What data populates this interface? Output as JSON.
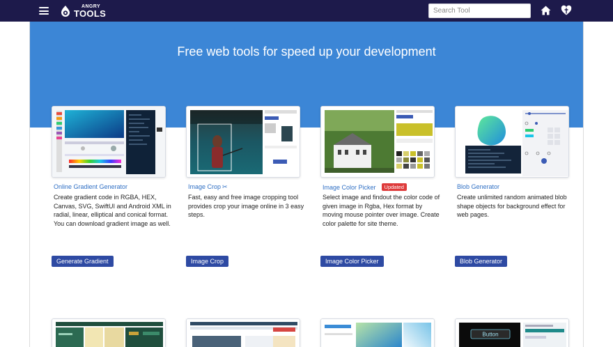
{
  "header": {
    "logo_top": "ANGRY",
    "logo_bottom": "TOOLS",
    "search_placeholder": "Search Tool"
  },
  "hero": {
    "title": "Free web tools for speed up your development"
  },
  "cards": [
    {
      "title": "Online Gradient Generator",
      "description": "Create gradient code in RGBA, HEX, Canvas, SVG, SwiftUI and Android XML in radial, linear, elliptical and conical format.\nYou can download gradient image as well.",
      "button": "Generate Gradient"
    },
    {
      "title": "Image Crop",
      "title_icon": "✂",
      "description": "Fast, easy and free image cropping tool provides crop your image online in 3 easy steps.",
      "button": "Image Crop"
    },
    {
      "title": "Image Color Picker",
      "badge": "Updated",
      "description": "Select image and findout the color code of given image in Rgba, Hex format by moving mouse pointer over image. Create color palette for site theme.",
      "button": "Image Color Picker"
    },
    {
      "title": "Blob Generator",
      "description": "Create unlimited random animated blob shape objects for background effect for web pages.",
      "button": "Blob Generator"
    }
  ],
  "colors": {
    "navbar": "#1d1a4b",
    "hero": "#3c86d6",
    "button": "#2e4aa3",
    "link": "#2f6fc4",
    "badge": "#de3b3b"
  },
  "icons": [
    "hamburger-menu-icon",
    "angry-tools-logo-icon",
    "home-icon",
    "heart-icon",
    "scissors-icon"
  ]
}
